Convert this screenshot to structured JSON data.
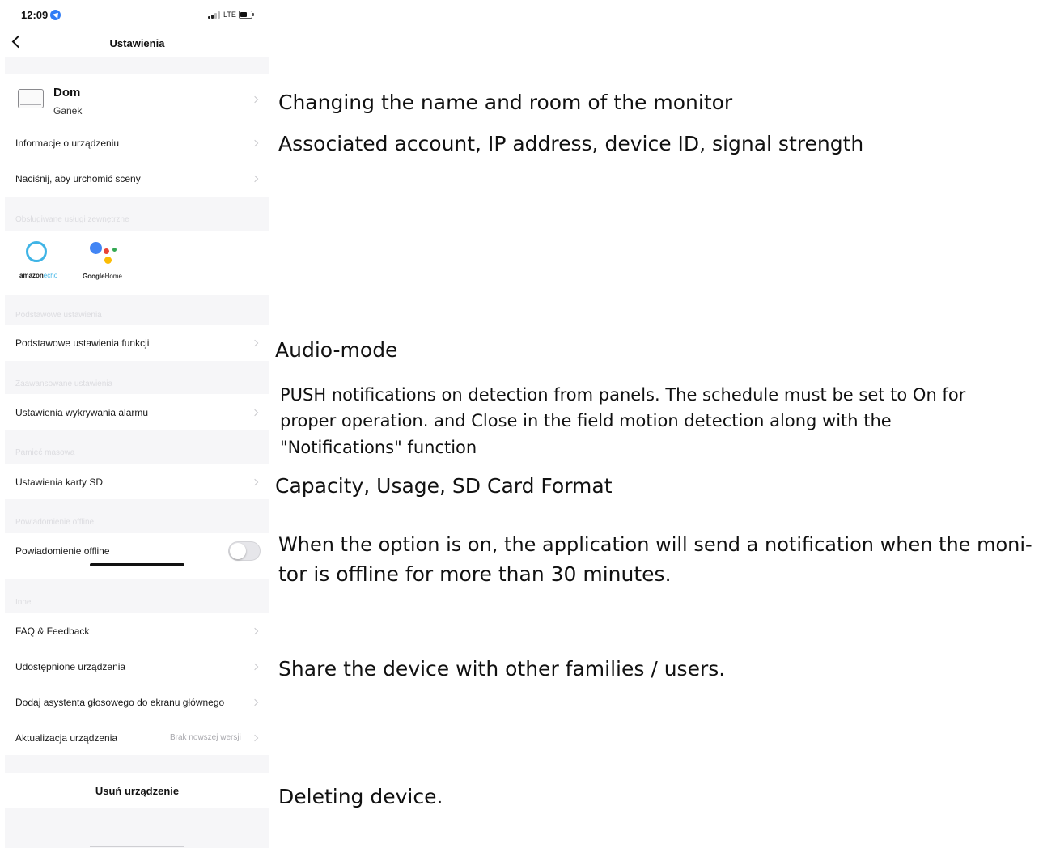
{
  "status_bar": {
    "time": "12:09",
    "network": "LTE"
  },
  "nav": {
    "title": "Ustawienia"
  },
  "device": {
    "name": "Dom",
    "room": "Ganek"
  },
  "rows": {
    "device_info": "Informacje o urządzeniu",
    "tap_to_run": "Naciśnij, aby urchomić sceny",
    "basic_settings": "Podstawowe ustawienia funkcji",
    "alarm_detection": "Ustawienia wykrywania alarmu",
    "sd_card": "Ustawienia karty SD",
    "offline_notification": "Powiadomienie offline",
    "faq": "FAQ & Feedback",
    "shared": "Udostępnione urządzenia",
    "add_voice": "Dodaj asystenta głosowego do ekranu głównego",
    "update": "Aktualizacja urządzenia",
    "update_value": "Brak nowszej wersji",
    "remove": "Usuń urządzenie"
  },
  "sections": {
    "third_party": "Obsługiwane usługi zewnętrzne",
    "basic": "Podstawowe ustawienia",
    "advanced": "Zaawansowane ustawienia",
    "storage": "Pamięć masowa",
    "offline": "Powiadomienie offline",
    "other": "Inne"
  },
  "integrations": {
    "amazon": {
      "brand": "amazon",
      "product": "echo"
    },
    "google": {
      "brand": "Google",
      "product": "Home"
    }
  },
  "toggles": {
    "offline_notification": false
  },
  "annotations": {
    "name_room": "Changing the name and room of the monitor",
    "device_info": "Associated account, IP address, device ID, signal strength",
    "audio_mode": "Audio-mode",
    "push_line1": "PUSH notifications on detection from panels. The schedule must be set to On for",
    "push_line2": "proper operation. and Close in the field motion detection along with the",
    "push_line3": "\"Notifications\" function",
    "sd_card": "Capacity, Usage, SD Card Format",
    "offline_line1": "When the option is on, the application will send a notification when the moni-",
    "offline_line2": "tor is offline for more than 30 minutes.",
    "share": "Share the device with other families / users.",
    "delete": "Deleting device."
  },
  "colors": {
    "section_bg": "#f6f6f8",
    "alexa_blue": "#3fb4e6",
    "google_blue": "#4285f4",
    "google_red": "#ea4335",
    "google_yellow": "#fbbc05",
    "google_green": "#34a853"
  }
}
